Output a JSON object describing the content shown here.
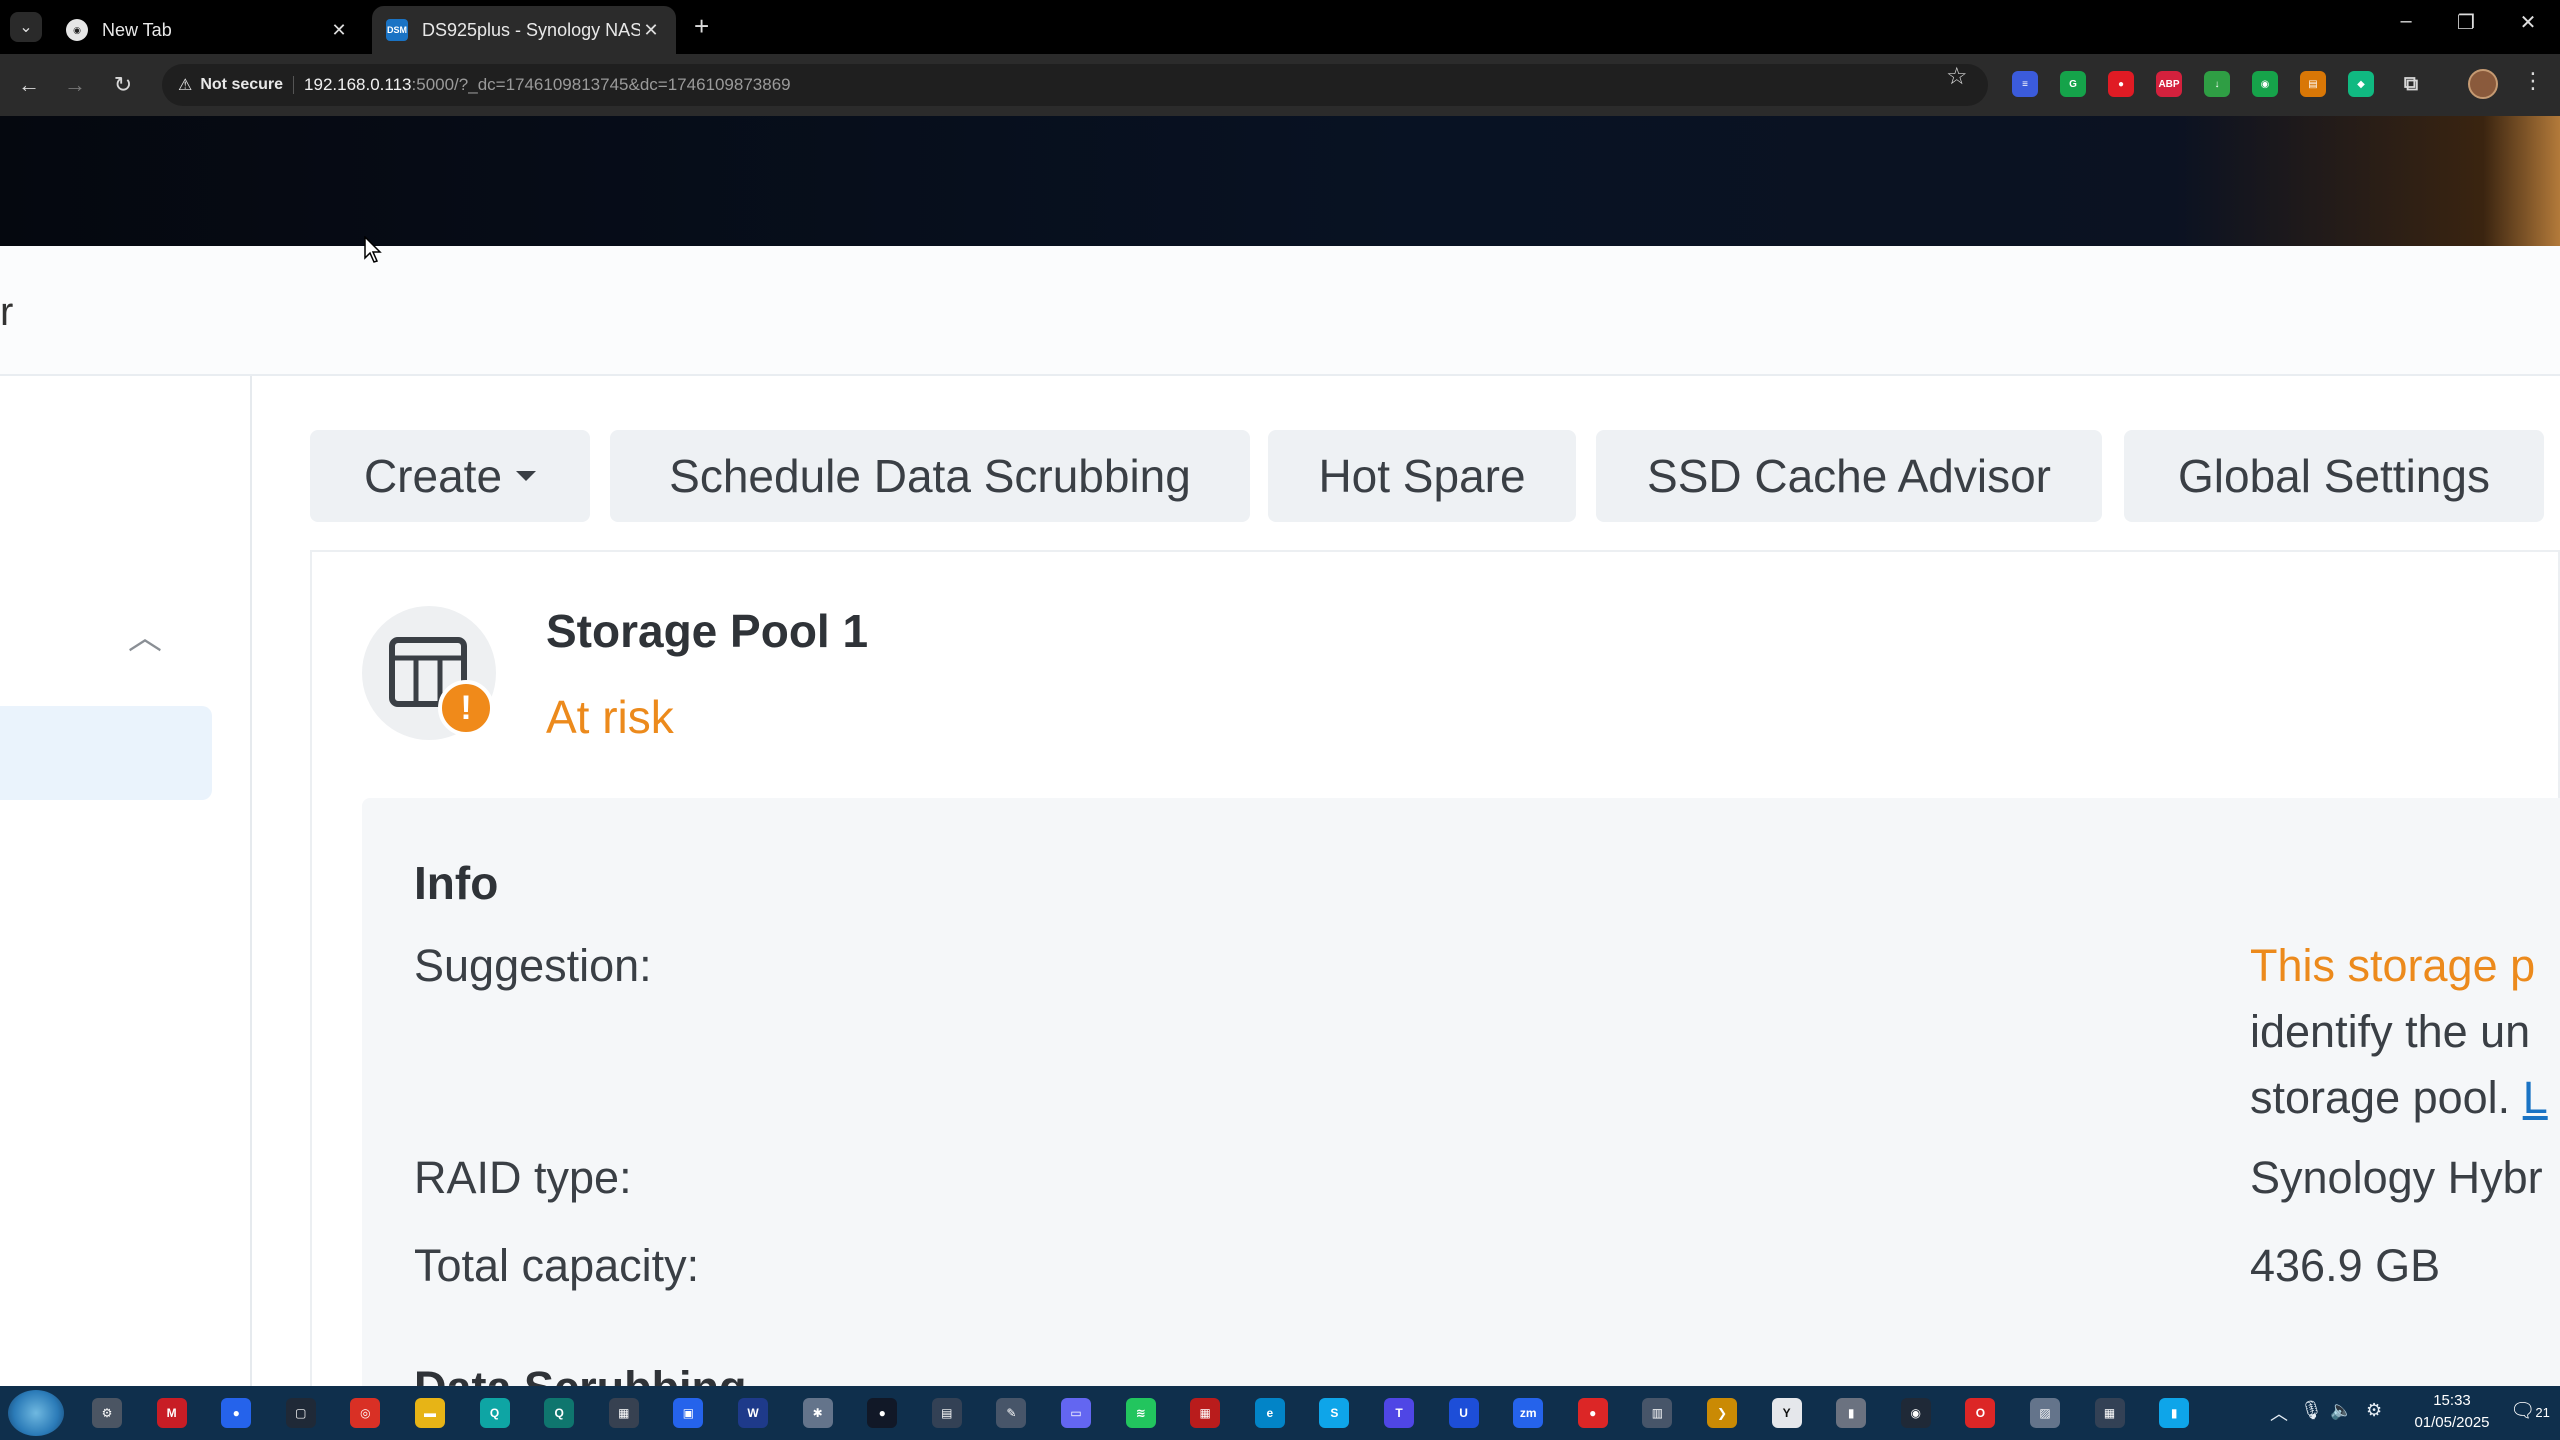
{
  "browser": {
    "tabs": [
      {
        "title": "New Tab",
        "close": "✕"
      },
      {
        "title": "DS925plus - Synology NAS",
        "close": "✕",
        "favicon_text": "DSM"
      }
    ],
    "new_tab": "+",
    "security_label": "Not secure",
    "url_host": "192.168.0.113",
    "url_rest": ":5000/?_dc=1746109813745&dc=1746109873869",
    "extensions": [
      {
        "name": "translate-ext",
        "color": "#3b5bdb",
        "label": "≡"
      },
      {
        "name": "grammarly-ext",
        "color": "#15a34a",
        "label": "G"
      },
      {
        "name": "red-ext",
        "color": "#e01b24",
        "label": "●"
      },
      {
        "name": "adblock-ext",
        "color": "#d4213d",
        "label": "ABP"
      },
      {
        "name": "download-ext",
        "color": "#2f9e44",
        "label": "↓"
      },
      {
        "name": "green-ext",
        "color": "#16a34a",
        "label": "◉"
      },
      {
        "name": "orange-ext",
        "color": "#d97706",
        "label": "▤"
      },
      {
        "name": "teal-ext",
        "color": "#10b981",
        "label": "◆"
      }
    ]
  },
  "dsm": {
    "header_fragment": "r",
    "actions": {
      "create": "Create",
      "scrubbing": "Schedule Data Scrubbing",
      "hot_spare": "Hot Spare",
      "ssd_cache": "SSD Cache Advisor",
      "global_settings": "Global Settings"
    },
    "pool": {
      "name": "Storage Pool 1",
      "status": "At risk",
      "status_color": "#ec8a1c"
    },
    "info": {
      "title": "Info",
      "suggestion_label": "Suggestion:",
      "suggestion_line1": "This storage p",
      "suggestion_line2": "identify the un",
      "suggestion_line3": "storage pool. ",
      "suggestion_link": "L",
      "raid_label": "RAID type:",
      "raid_value": "Synology Hybr",
      "capacity_label": "Total capacity:",
      "capacity_value": "436.9 GB",
      "next_section": "Data Scrubbing"
    }
  },
  "taskbar": {
    "apps": [
      {
        "name": "settings-app",
        "color": "#4b5563",
        "label": "⚙"
      },
      {
        "name": "mcafee-app",
        "color": "#c81d25",
        "label": "M"
      },
      {
        "name": "dot-app",
        "color": "#2563eb",
        "label": "●"
      },
      {
        "name": "window-app",
        "color": "#1f2937",
        "label": "▢"
      },
      {
        "name": "chrome-app",
        "color": "#d93025",
        "label": "◎"
      },
      {
        "name": "explorer-app",
        "color": "#e7b416",
        "label": "▬"
      },
      {
        "name": "search-app",
        "color": "#0ea5a4",
        "label": "Q"
      },
      {
        "name": "magnifier-app",
        "color": "#0f766e",
        "label": "Q"
      },
      {
        "name": "calc-app",
        "color": "#374151",
        "label": "▦"
      },
      {
        "name": "store-app",
        "color": "#2563eb",
        "label": "▣"
      },
      {
        "name": "word-app",
        "color": "#1e3a8a",
        "label": "W"
      },
      {
        "name": "network-app",
        "color": "#64748b",
        "label": "✱"
      },
      {
        "name": "red-black-app",
        "color": "#111827",
        "label": "●"
      },
      {
        "name": "doc-app",
        "color": "#334155",
        "label": "▤"
      },
      {
        "name": "edit-app",
        "color": "#475569",
        "label": "✎"
      },
      {
        "name": "monitor-app",
        "color": "#6366f1",
        "label": "▭"
      },
      {
        "name": "green-app",
        "color": "#22c55e",
        "label": "≋"
      },
      {
        "name": "grid-app",
        "color": "#b91c1c",
        "label": "▦"
      },
      {
        "name": "browser-app",
        "color": "#0284c7",
        "label": "e"
      },
      {
        "name": "skype-app",
        "color": "#0ea5e9",
        "label": "S"
      },
      {
        "name": "teams-app",
        "color": "#4f46e5",
        "label": "T"
      },
      {
        "name": "u-app",
        "color": "#1d4ed8",
        "label": "U"
      },
      {
        "name": "zoom-app",
        "color": "#2563eb",
        "label": "zm"
      },
      {
        "name": "record-app",
        "color": "#dc2626",
        "label": "●"
      },
      {
        "name": "remote-app",
        "color": "#475569",
        "label": "▥"
      },
      {
        "name": "terminal-app",
        "color": "#ca8a04",
        "label": "❯"
      },
      {
        "name": "yandex-app",
        "color": "#e5e7eb",
        "label": "Y"
      },
      {
        "name": "usb-app",
        "color": "#6b7280",
        "label": "▮"
      },
      {
        "name": "media-app",
        "color": "#1f2937",
        "label": "◉"
      },
      {
        "name": "opera-app",
        "color": "#dc2626",
        "label": "O"
      },
      {
        "name": "chart-app",
        "color": "#64748b",
        "label": "▨"
      },
      {
        "name": "calculator-app",
        "color": "#334155",
        "label": "▦"
      },
      {
        "name": "bars-app",
        "color": "#0ea5e9",
        "label": "▮"
      }
    ],
    "time": "15:33",
    "date": "01/05/2025",
    "notification_count": "21"
  }
}
